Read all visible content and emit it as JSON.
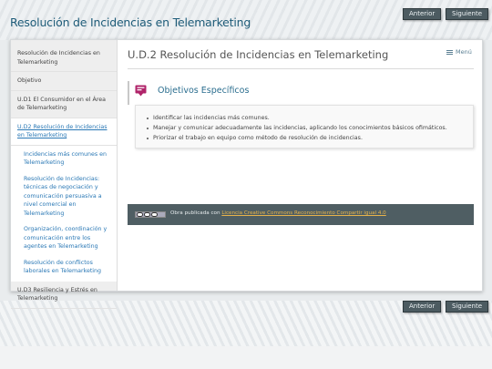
{
  "site": {
    "title": "Resolución de Incidencias en Telemarketing"
  },
  "nav_buttons": {
    "previous": "Anterior",
    "next": "Siguiente"
  },
  "sidebar": {
    "items": [
      {
        "label": "Resolución de Incidencias en Telemarketing"
      },
      {
        "label": "Objetivo"
      },
      {
        "label": "U.D1 El Consumidor en el Área de Telemarketing"
      },
      {
        "label": "U.D2 Resolución de Incidencias en Telemarketing",
        "active": true
      },
      {
        "label": "U.D3 Resiliencia y Estrés en Telemarketing"
      }
    ],
    "subitems": [
      {
        "label": "Incidencias más comunes en Telemarketing"
      },
      {
        "label": "Resolución de Incidencias: técnicas de negociación y comunicación persuasiva a nivel comercial en Telemarketing"
      },
      {
        "label": "Organización, coordinación y comunicación entre los agentes en Telemarketing"
      },
      {
        "label": "Resolución de conflictos laborales en Telemarketing"
      }
    ]
  },
  "content": {
    "page_title": "U.D.2 Resolución de Incidencias en Telemarketing",
    "menu_label": "Menú",
    "idevice": {
      "title": "Objetivos Específicos",
      "icon": "objectives-icon",
      "items": [
        "Identificar las incidencias más comunes.",
        "Manejar y comunicar adecuadamente las incidencias, aplicando los conocimientos básicos ofimáticos.",
        "Priorizar el trabajo en equipo como método de resolución de incidencias."
      ]
    },
    "license": {
      "prefix": "Obra publicada con",
      "link_text": "Licencia Creative Commons Reconocimiento Compartir igual 4.0"
    }
  },
  "colors": {
    "accent": "#1d5b78",
    "nav_button": "#4c5b61",
    "license_bar": "#4f5e63",
    "icon": "#b0246a"
  }
}
